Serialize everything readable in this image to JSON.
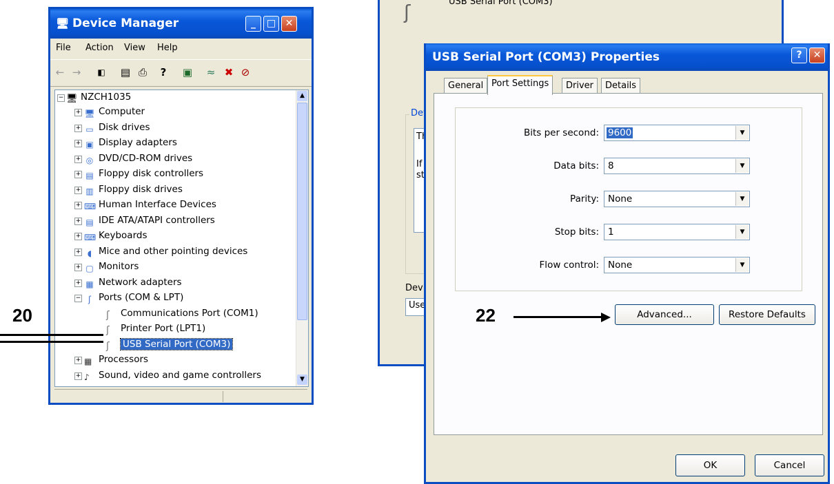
{
  "device_manager": {
    "title": "Device Manager",
    "menu": [
      "File",
      "Action",
      "View",
      "Help"
    ],
    "computer_name": "NZCH1035",
    "tree": [
      {
        "label": "Computer",
        "icon": "computer-icon"
      },
      {
        "label": "Disk drives",
        "icon": "disk-drive-icon"
      },
      {
        "label": "Display adapters",
        "icon": "display-adapter-icon"
      },
      {
        "label": "DVD/CD-ROM drives",
        "icon": "cdrom-icon"
      },
      {
        "label": "Floppy disk controllers",
        "icon": "floppy-controller-icon"
      },
      {
        "label": "Floppy disk drives",
        "icon": "floppy-drive-icon"
      },
      {
        "label": "Human Interface Devices",
        "icon": "hid-icon"
      },
      {
        "label": "IDE ATA/ATAPI controllers",
        "icon": "ide-controller-icon"
      },
      {
        "label": "Keyboards",
        "icon": "keyboard-icon"
      },
      {
        "label": "Mice and other pointing devices",
        "icon": "mouse-icon"
      },
      {
        "label": "Monitors",
        "icon": "monitor-icon"
      },
      {
        "label": "Network adapters",
        "icon": "network-adapter-icon"
      },
      {
        "label": "Ports (COM & LPT)",
        "icon": "port-icon"
      }
    ],
    "ports_children": [
      "Communications Port (COM1)",
      "Printer Port (LPT1)",
      "USB Serial Port (COM3)"
    ],
    "after_ports": [
      "Processors",
      "Sound, video and game controllers"
    ]
  },
  "background_window": {
    "title_fragment": "USB Serial Port (COM3)",
    "group_fragment": "Dev",
    "text1": "Th",
    "text2a": "If y",
    "text2b": "sta",
    "device_usage_fragment": "Devic",
    "usage_value_fragment": "Use"
  },
  "properties": {
    "title": "USB Serial Port (COM3) Properties",
    "help_label": "?",
    "tabs": [
      "General",
      "Port Settings",
      "Driver",
      "Details"
    ],
    "active_tab": "Port Settings",
    "fields": [
      {
        "label": "Bits per second:",
        "value": "9600"
      },
      {
        "label": "Data bits:",
        "value": "8"
      },
      {
        "label": "Parity:",
        "value": "None"
      },
      {
        "label": "Stop bits:",
        "value": "1"
      },
      {
        "label": "Flow control:",
        "value": "None"
      }
    ],
    "advanced_label": "Advanced...",
    "restore_label": "Restore Defaults",
    "ok_label": "OK",
    "cancel_label": "Cancel"
  },
  "callouts": {
    "left": "20",
    "right": "22"
  },
  "colors": {
    "title_blue": "#0a5ed8",
    "selection": "#316ac5",
    "window_face": "#ece9d8"
  }
}
